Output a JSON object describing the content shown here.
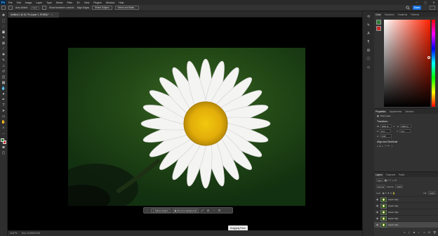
{
  "app": {
    "logo": "Ps",
    "menu": [
      "File",
      "Edit",
      "Image",
      "Layer",
      "Type",
      "Select",
      "Filter",
      "3D",
      "View",
      "Plugins",
      "Window",
      "Help"
    ],
    "window_controls": [
      "─",
      "▢",
      "✕"
    ]
  },
  "options": {
    "show_transform": "Show transform controls",
    "auto_select_label": "Auto-Select:",
    "auto_select_value": "Layer",
    "align_edges": "Align Edges",
    "auto_select_btn": "Select Subject",
    "select_mask_btn": "Select and Mask...",
    "share": "Share"
  },
  "document": {
    "tab_title": "Untitled-1 @ 16.7% (Layer 1, RGB/8) *",
    "close": "×"
  },
  "context_bar": {
    "select_subject": "Select subject",
    "remove_background": "Remove background",
    "more": "···"
  },
  "tooltip": "Dragging Pane",
  "status": {
    "zoom": "16.67%",
    "doc_size": "Doc: 24.9M/24.9M"
  },
  "panels": {
    "color_tabs": [
      "Color",
      "Swatches",
      "Gradients",
      "Patterns"
    ],
    "props_tabs": [
      "Properties",
      "Adjustments",
      "Libraries"
    ],
    "props": {
      "section_pixel": "Pixel Layer",
      "transform_head": "Transform",
      "w_label": "W",
      "w_value": "3000 px",
      "h_label": "H",
      "h_value": "2000 px",
      "x_label": "X",
      "x_value": "0 px",
      "y_label": "Y",
      "y_value": "0 px",
      "angle": "0.00°",
      "align_head": "Align and Distribute"
    },
    "layers_tabs": [
      "Layers",
      "Channels",
      "Paths"
    ],
    "layers": {
      "kind": "Kind",
      "mode": "Normal",
      "opacity_label": "Opacity:",
      "opacity_value": "100%",
      "lock_label": "Lock:",
      "fill_label": "Fill:",
      "fill_value": "100%",
      "items": [
        "Layer copy",
        "Layer copy",
        "Layer copy",
        "Layer copy",
        "Layer copy"
      ]
    }
  },
  "colors": {
    "foreground": "#2e7d32",
    "background": "#c62828",
    "accent": "#1473e6"
  }
}
